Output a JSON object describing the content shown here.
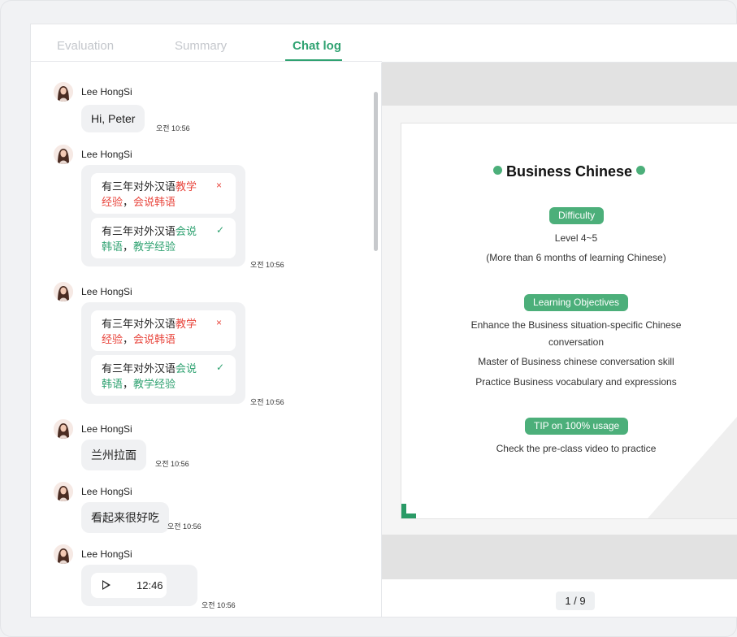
{
  "tabs": [
    "Evaluation",
    "Summary",
    "Chat log"
  ],
  "active_tab": "Chat log",
  "chat": {
    "messages": [
      {
        "sender": "Lee HongSi",
        "type": "text",
        "text": "Hi, Peter",
        "time": "오전 10:56"
      },
      {
        "sender": "Lee HongSi",
        "type": "correction",
        "time": "오전 10:56",
        "wrong": {
          "plain": "有三年对外汉语",
          "highlight1": "教学",
          "highlight2": "经验",
          "sep": "，",
          "highlight3": "会说韩语"
        },
        "right": {
          "plain": "有三年对外汉语",
          "highlight1": "会说",
          "highlight2": "韩语",
          "sep": "，",
          "highlight3": "教学经验"
        }
      },
      {
        "sender": "Lee HongSi",
        "type": "correction",
        "time": "오전 10:56",
        "wrong": {
          "plain": "有三年对外汉语",
          "highlight1": "教学",
          "highlight2": "经验",
          "sep": "，",
          "highlight3": "会说韩语"
        },
        "right": {
          "plain": "有三年对外汉语",
          "highlight1": "会说",
          "highlight2": "韩语",
          "sep": "，",
          "highlight3": "教学经验"
        }
      },
      {
        "sender": "Lee HongSi",
        "type": "text",
        "text": "兰州拉面",
        "time": "오전 10:56"
      },
      {
        "sender": "Lee HongSi",
        "type": "text",
        "text": "看起来很好吃",
        "time": "오전 10:56"
      },
      {
        "sender": "Lee HongSi",
        "type": "audio",
        "duration": "12:46",
        "time": "오전 10:56"
      }
    ],
    "wrong_mark": "×",
    "right_mark": "✓"
  },
  "slide": {
    "title": "Business Chinese",
    "difficulty_label": "Difficulty",
    "difficulty_lines": [
      "Level 4~5",
      "(More than 6 months of learning Chinese)"
    ],
    "objectives_label": "Learning Objectives",
    "objectives_lines": [
      "Enhance the Business situation-specific Chinese",
      "conversation",
      "Master of Business chinese conversation skill",
      "Practice Business vocabulary and expressions"
    ],
    "tip_label": "TIP on 100% usage",
    "tip_lines": [
      "Check the pre-class video to practice"
    ],
    "page": "1 / 9"
  },
  "colors": {
    "accent": "#2fa271",
    "error": "#e8453c",
    "pill": "#4caf7a"
  }
}
